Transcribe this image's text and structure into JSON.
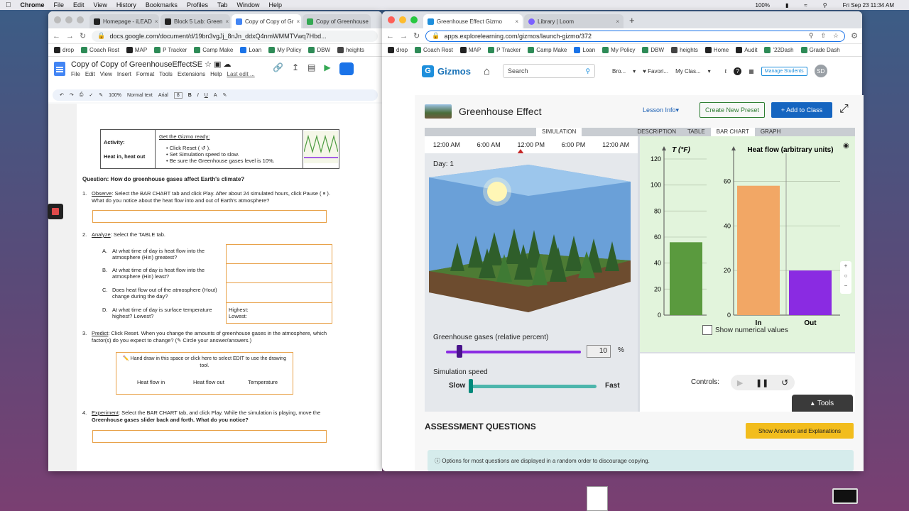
{
  "menubar": {
    "app": "Chrome",
    "items": [
      "File",
      "Edit",
      "View",
      "History",
      "Bookmarks",
      "Profiles",
      "Tab",
      "Window",
      "Help"
    ],
    "battery": "100%",
    "datetime": "Fri Sep 23  11:34 AM"
  },
  "left_window": {
    "tabs": [
      "Homepage - iLEAD",
      "Block 5 Lab: Green",
      "Copy of Copy of Gr",
      "Copy of Greenhouse"
    ],
    "url": "docs.google.com/document/d/19bn3vgJj_8nJn_ddxQ4nmWMMTVwq7Hbd...",
    "bookmarks": [
      "drop",
      "Coach Rost",
      "MAP",
      "P Tracker",
      "Camp Make",
      "Loan",
      "My Policy",
      "DBW",
      "heights"
    ],
    "doc_title": "Copy of Copy of GreenhouseEffectSE",
    "doc_menu": [
      "File",
      "Edit",
      "View",
      "Insert",
      "Format",
      "Tools",
      "Extensions",
      "Help",
      "Last edit ..."
    ],
    "toolbar": {
      "zoom": "100%",
      "style": "Normal text",
      "font": "Arial",
      "size": "8"
    },
    "activity": {
      "label": "Activity:",
      "name": "Heat in, heat out",
      "header": "Get the Gizmo ready:",
      "steps": [
        "Click Reset ( ↺ ).",
        "Set Simulation speed to slow.",
        "Be sure the Greenhouse gases level is 10%."
      ]
    },
    "question": "Question: How do greenhouse gases affect Earth's climate?",
    "q1": {
      "num": "1.",
      "lead": "Observe",
      "text": ": Select the BAR CHART tab and click Play. After about 24 simulated hours, click Pause ( ⏸ ).",
      "text2": "What do you notice about the heat flow into and out of Earth's atmosphere?"
    },
    "q2": {
      "num": "2.",
      "lead": "Analyze",
      "text": ": Select the TABLE tab.",
      "items": [
        {
          "l": "A.",
          "t": "At what time of day is heat flow into the",
          "t2": "atmosphere (Hin) greatest?"
        },
        {
          "l": "B.",
          "t": "At what time of day is heat flow into the",
          "t2": "atmosphere (Hin) least?"
        },
        {
          "l": "C.",
          "t": "Does heat flow out of the atmosphere (Hout)",
          "t2": "change during the day?"
        },
        {
          "l": "D.",
          "t": "At what time of day is surface temperature",
          "t2": "highest? Lowest?"
        }
      ],
      "highest": "Highest:",
      "lowest": "Lowest:"
    },
    "q3": {
      "num": "3.",
      "lead": "Predict",
      "text": ": Click Reset. When you change the amounts of greenhouse gases in the atmosphere, which",
      "text2": "factor(s) do you expect to change? (✎ Circle your answer/answers.)",
      "box_hint": "✏️ Hand draw in this space or click here to select EDIT to use the drawing",
      "box_hint2": "tool.",
      "options": [
        "Heat flow in",
        "Heat flow out",
        "Temperature"
      ]
    },
    "q4": {
      "num": "4.",
      "lead": "Experiment",
      "text": ": Select the BAR CHART tab, and click Play. While the simulation is playing, move the",
      "text2": "Greenhouse gases slider back and forth. What do you notice?"
    }
  },
  "right_window": {
    "tabs": [
      "Greenhouse Effect Gizmo",
      "Library | Loom"
    ],
    "url": "apps.explorelearning.com/gizmos/launch-gizmo/372",
    "bookmarks": [
      "drop",
      "Coach Rost",
      "MAP",
      "P Tracker",
      "Camp Make",
      "Loan",
      "My Policy",
      "DBW",
      "heights",
      "Home",
      "Audit",
      "'22Dash",
      "Grade Dash"
    ],
    "brand": "Gizmos",
    "search_placeholder": "Search",
    "nav": [
      "Bro...",
      "Favori...",
      "My Clas..."
    ],
    "manage": "Manage Students",
    "avatar": "SD",
    "title": "Greenhouse Effect",
    "lesson_info": "Lesson Info",
    "create_preset": "Create New Preset",
    "add_class": "+ Add to Class",
    "tabs_left": [
      "SIMULATION"
    ],
    "tabs_right": [
      "DESCRIPTION",
      "TABLE",
      "BAR CHART",
      "GRAPH"
    ],
    "times": [
      "12:00 AM",
      "6:00 AM",
      "12:00 PM",
      "6:00 PM",
      "12:00 AM"
    ],
    "day": "Day: 1",
    "gg_label": "Greenhouse gases (relative percent)",
    "gg_value": "10",
    "gg_unit": "%",
    "gg_level": 0.1,
    "speed_label": "Simulation speed",
    "slow": "Slow",
    "fast": "Fast",
    "speed_level": 0.0,
    "controls_label": "Controls:",
    "tools": "Tools",
    "show_numeric": "Show numerical values",
    "assessment": "ASSESSMENT QUESTIONS",
    "show_answers": "Show Answers and Explanations",
    "info": "Options for most questions are displayed in a random order to discourage copying.",
    "colors": {
      "temp": "#5a9a3e",
      "in": "#f2a765",
      "out": "#8a2be2",
      "gizmo_blue": "#1e8fdc"
    }
  },
  "chart_data": [
    {
      "type": "bar",
      "title": "T (°F)",
      "categories": [
        ""
      ],
      "values": [
        56
      ],
      "ylim": [
        0,
        120
      ],
      "yticks": [
        0,
        20,
        40,
        60,
        80,
        100,
        120
      ]
    },
    {
      "type": "bar",
      "title": "Heat flow (arbitrary units)",
      "categories": [
        "In",
        "Out"
      ],
      "values": [
        58,
        20
      ],
      "ylim": [
        0,
        70
      ],
      "yticks": [
        0,
        20,
        40,
        60
      ]
    }
  ]
}
